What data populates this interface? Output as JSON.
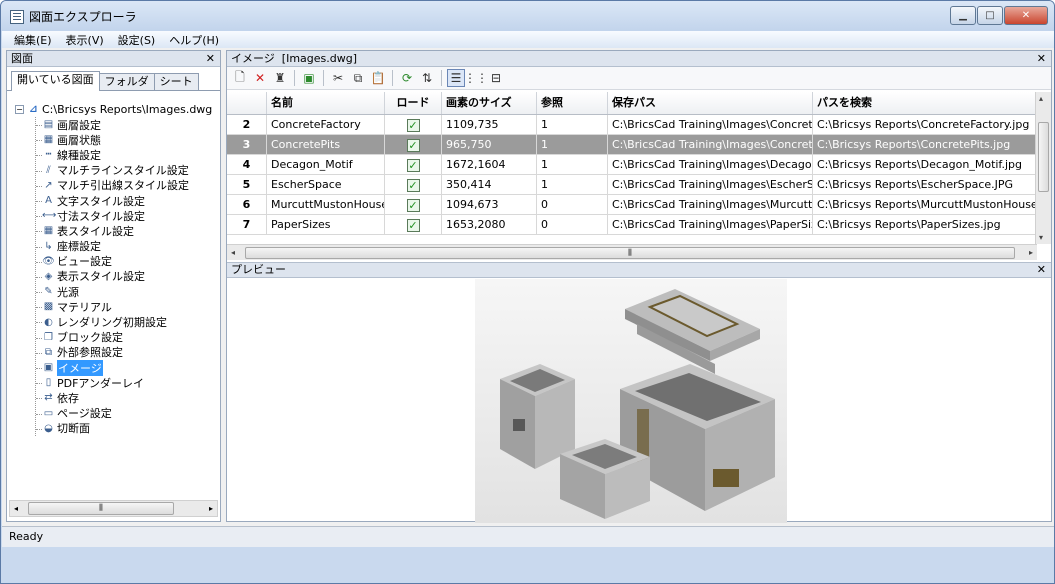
{
  "window": {
    "title": "図面エクスプローラ"
  },
  "menu": [
    "編集(E)",
    "表示(V)",
    "設定(S)",
    "ヘルプ(H)"
  ],
  "left_pane": {
    "header": "図面",
    "tabs": [
      "開いている図面",
      "フォルダ",
      "シート"
    ],
    "root": "C:\\Bricsys Reports\\Images.dwg",
    "items": [
      {
        "label": "画層設定",
        "icon": "layers-icon"
      },
      {
        "label": "画層状態",
        "icon": "layer-state-icon"
      },
      {
        "label": "線種設定",
        "icon": "linetype-icon"
      },
      {
        "label": "マルチラインスタイル設定",
        "icon": "multiline-icon"
      },
      {
        "label": "マルチ引出線スタイル設定",
        "icon": "multileader-icon"
      },
      {
        "label": "文字スタイル設定",
        "icon": "text-style-icon"
      },
      {
        "label": "寸法スタイル設定",
        "icon": "dimension-style-icon"
      },
      {
        "label": "表スタイル設定",
        "icon": "table-style-icon"
      },
      {
        "label": "座標設定",
        "icon": "ucs-icon"
      },
      {
        "label": "ビュー設定",
        "icon": "view-icon"
      },
      {
        "label": "表示スタイル設定",
        "icon": "visual-style-icon"
      },
      {
        "label": "光源",
        "icon": "light-icon"
      },
      {
        "label": "マテリアル",
        "icon": "material-icon"
      },
      {
        "label": "レンダリング初期設定",
        "icon": "render-preset-icon"
      },
      {
        "label": "ブロック設定",
        "icon": "block-icon"
      },
      {
        "label": "外部参照設定",
        "icon": "xref-icon"
      },
      {
        "label": "イメージ",
        "icon": "image-icon",
        "selected": true
      },
      {
        "label": "PDFアンダーレイ",
        "icon": "pdf-icon"
      },
      {
        "label": "依存",
        "icon": "dependency-icon"
      },
      {
        "label": "ページ設定",
        "icon": "page-setup-icon"
      },
      {
        "label": "切断面",
        "icon": "section-icon"
      }
    ]
  },
  "right_pane": {
    "header_label": "イメージ",
    "header_file": "[Images.dwg]",
    "columns": [
      "",
      "名前",
      "ロード",
      "画素のサイズ",
      "参照",
      "保存パス",
      "パスを検索"
    ],
    "rows": [
      {
        "num": "2",
        "name": "ConcreteFactory",
        "loaded": true,
        "size": "1109,735",
        "refs": "1",
        "saved": "C:\\BricsCad Training\\Images\\ConcreteFa",
        "found": "C:\\Bricsys Reports\\ConcreteFactory.jpg"
      },
      {
        "num": "3",
        "name": "ConcretePits",
        "loaded": true,
        "size": "965,750",
        "refs": "1",
        "saved": "C:\\BricsCad Training\\Images\\ConcretePit",
        "found": "C:\\Bricsys Reports\\ConcretePits.jpg",
        "selected": true
      },
      {
        "num": "4",
        "name": "Decagon_Motif",
        "loaded": true,
        "size": "1672,1604",
        "refs": "1",
        "saved": "C:\\BricsCad Training\\Images\\Decagon_M",
        "found": "C:\\Bricsys Reports\\Decagon_Motif.jpg"
      },
      {
        "num": "5",
        "name": "EscherSpace",
        "loaded": true,
        "size": "350,414",
        "refs": "1",
        "saved": "C:\\BricsCad Training\\Images\\EscherSpac",
        "found": "C:\\Bricsys Reports\\EscherSpace.JPG"
      },
      {
        "num": "6",
        "name": "MurcuttMustonHouse",
        "loaded": true,
        "size": "1094,673",
        "refs": "0",
        "saved": "C:\\BricsCad Training\\Images\\MurcuttMus",
        "found": "C:\\Bricsys Reports\\MurcuttMustonHouse.jp"
      },
      {
        "num": "7",
        "name": "PaperSizes",
        "loaded": true,
        "size": "1653,2080",
        "refs": "0",
        "saved": "C:\\BricsCad Training\\Images\\PaperSizes.",
        "found": "C:\\Bricsys Reports\\PaperSizes.jpg"
      }
    ],
    "preview_header": "プレビュー"
  },
  "status": "Ready"
}
